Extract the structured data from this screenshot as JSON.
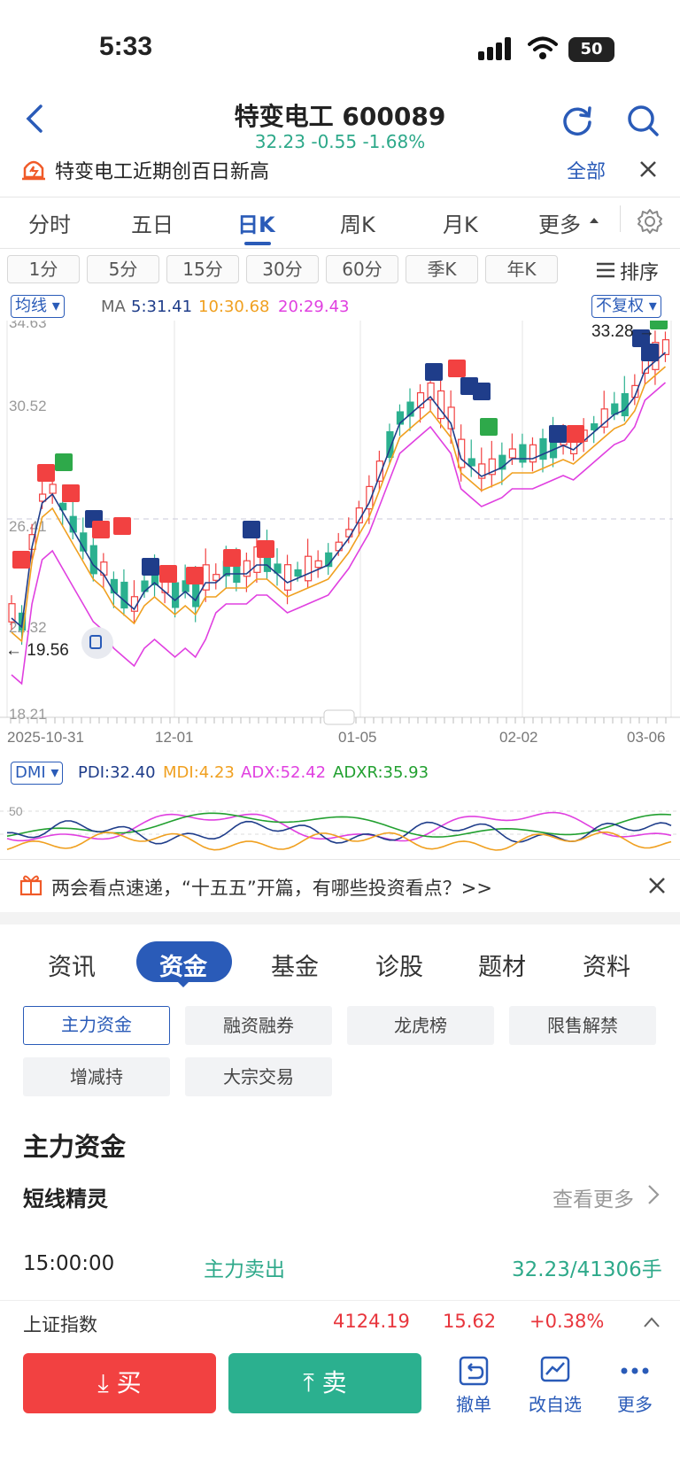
{
  "status": {
    "time": "5:33",
    "battery": "50"
  },
  "header": {
    "title": "特变电工 600089",
    "quote": "32.23 -0.55 -1.68%"
  },
  "alert": {
    "text": "特变电工近期创百日新高",
    "all_label": "全部"
  },
  "period_tabs": [
    "分时",
    "五日",
    "日K",
    "周K",
    "月K",
    "更多"
  ],
  "minute_tabs": [
    "1分",
    "5分",
    "15分",
    "30分",
    "60分",
    "季K",
    "年K"
  ],
  "sort_label": "排序",
  "ma": {
    "label": "均线",
    "prefix": "MA",
    "v1": "5:31.41",
    "v2": "10:30.68",
    "v3": "20:29.43",
    "adjust": "不复权"
  },
  "chart": {
    "y_ticks": [
      "34.63",
      "30.52",
      "26.41",
      "22.32",
      "18.21"
    ],
    "x_ticks": [
      "2025-10-31",
      "12-01",
      "01-05",
      "02-02",
      "03-06"
    ],
    "high_label": "33.28",
    "low_label": "19.56"
  },
  "dmi": {
    "label": "DMI",
    "pdi": "PDI:32.40",
    "mdi": "MDI:4.23",
    "adx": "ADX:52.42",
    "adxr": "ADXR:35.93",
    "level": "50"
  },
  "banner": {
    "text": "两会看点速递，“十五五”开篇，有哪些投资看点？>>"
  },
  "feature_tabs": [
    "资讯",
    "资金",
    "基金",
    "诊股",
    "题材",
    "资料"
  ],
  "sub_buttons": [
    "主力资金",
    "融资融券",
    "龙虎榜",
    "限售解禁",
    "增减持",
    "大宗交易"
  ],
  "section": {
    "title": "主力资金",
    "subtitle": "短线精灵",
    "more": "查看更多"
  },
  "record": {
    "time": "15:00:00",
    "type": "主力卖出",
    "value": "32.23/41306手"
  },
  "index": {
    "name": "上证指数",
    "value": "4124.19",
    "change": "15.62",
    "pct": "+0.38%"
  },
  "actions": {
    "buy": "买",
    "sell": "卖",
    "cancel": "撤单",
    "edit": "改自选",
    "more": "更多"
  },
  "colors": {
    "up": "#f24141",
    "down": "#2bb08f",
    "accent": "#2a5bb8",
    "ma10": "#f0a020",
    "ma20": "#e040e0"
  }
}
